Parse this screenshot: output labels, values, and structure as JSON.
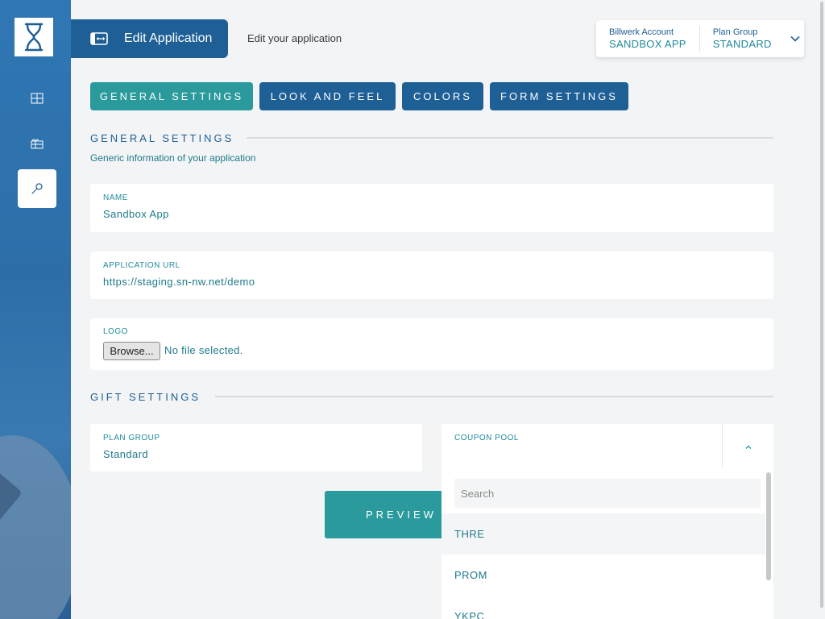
{
  "header": {
    "title": "Edit Application",
    "subtitle": "Edit your application"
  },
  "account": {
    "account_label": "Billwerk Account",
    "account_value": "SANDBOX APP",
    "plan_label": "Plan Group",
    "plan_value": "STANDARD"
  },
  "sidebar": {
    "items": [
      {
        "icon": "grid-icon"
      },
      {
        "icon": "gift-icon"
      },
      {
        "icon": "wrench-icon",
        "active": true
      }
    ]
  },
  "tabs": [
    {
      "label": "GENERAL SETTINGS",
      "active": true
    },
    {
      "label": "LOOK AND FEEL"
    },
    {
      "label": "COLORS"
    },
    {
      "label": "FORM SETTINGS"
    }
  ],
  "general": {
    "heading": "GENERAL SETTINGS",
    "description": "Generic information of your application",
    "name_label": "NAME",
    "name_value": "Sandbox App",
    "url_label": "APPLICATION URL",
    "url_value": "https://staging.sn-nw.net/demo",
    "logo_label": "LOGO",
    "browse_label": "Browse...",
    "file_status": "No file selected."
  },
  "gift": {
    "heading": "GIFT SETTINGS",
    "plan_group_label": "PLAN GROUP",
    "plan_group_value": "Standard",
    "coupon_pool_label": "COUPON POOL",
    "search_placeholder": "Search",
    "options": [
      "THRE",
      "PROM",
      "YKPC"
    ]
  },
  "preview_button": "PREVIEW C",
  "colors": {
    "primary": "#1e5f96",
    "accent": "#2a9a9c",
    "text": "#1f7a8c"
  }
}
